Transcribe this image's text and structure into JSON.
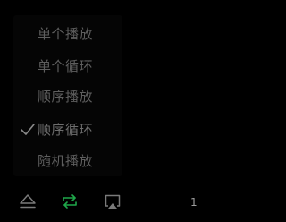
{
  "menu": {
    "items": [
      {
        "label": "单个播放",
        "selected": false
      },
      {
        "label": "单个循环",
        "selected": false
      },
      {
        "label": "顺序播放",
        "selected": false
      },
      {
        "label": "顺序循环",
        "selected": true
      },
      {
        "label": "随机播放",
        "selected": false
      }
    ]
  },
  "toolbar": {
    "buttons": [
      {
        "icon": "eject-icon"
      },
      {
        "icon": "repeat-icon",
        "active": true
      },
      {
        "icon": "airplay-icon"
      }
    ]
  },
  "edge_glyph": "1",
  "colors": {
    "background": "#000000",
    "menu_bg": "#050505",
    "menu_text": "#5e5e5e",
    "icon_inactive": "#7a7a7a",
    "accent_green": "#1fa84a"
  }
}
